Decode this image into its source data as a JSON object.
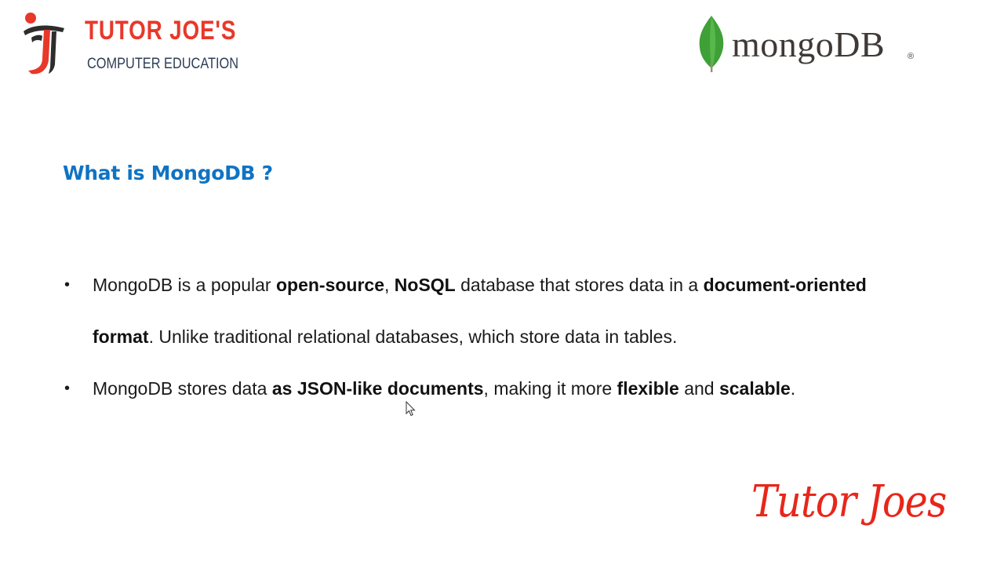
{
  "brand": {
    "title": "TUTOR JOE'S",
    "subtitle": "COMPUTER EDUCATION",
    "signature": "Tutor Joes",
    "accent_color": "#e8382a",
    "subtitle_color": "#2d3e55"
  },
  "mongo_logo": {
    "wordmark": "mongoDB",
    "registered": "®",
    "leaf_color": "#3fa037",
    "text_color": "#3f3a37"
  },
  "slide": {
    "heading": "What is MongoDB ?",
    "heading_color": "#0f73c4",
    "bullets": [
      {
        "segments": [
          {
            "text": "MongoDB is a popular ",
            "bold": false
          },
          {
            "text": "open-source",
            "bold": true
          },
          {
            "text": ", ",
            "bold": false
          },
          {
            "text": "NoSQL",
            "bold": true
          },
          {
            "text": " database that stores data in a ",
            "bold": false
          },
          {
            "text": "document-oriented format",
            "bold": true
          },
          {
            "text": ". Unlike traditional relational databases, which store data in tables.",
            "bold": false
          }
        ]
      },
      {
        "segments": [
          {
            "text": "MongoDB stores data ",
            "bold": false
          },
          {
            "text": "as JSON-like documents",
            "bold": true
          },
          {
            "text": ", making it more ",
            "bold": false
          },
          {
            "text": "flexible",
            "bold": true
          },
          {
            "text": " and ",
            "bold": false
          },
          {
            "text": "scalable",
            "bold": true
          },
          {
            "text": ".",
            "bold": false
          }
        ]
      }
    ]
  },
  "icons": {
    "logo_mark": "tutor-joes-figure-icon",
    "leaf": "mongodb-leaf-icon",
    "bullet": "bullet-dot-icon",
    "cursor": "mouse-pointer-icon"
  }
}
